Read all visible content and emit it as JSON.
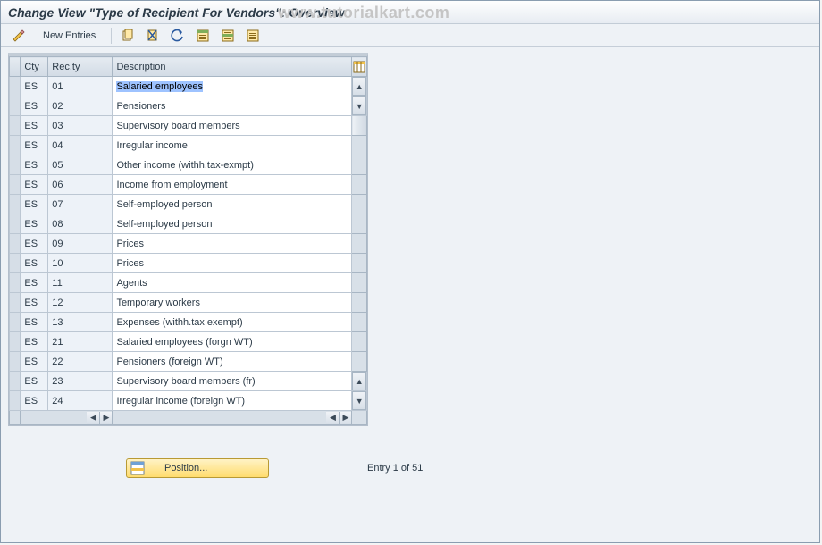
{
  "title": "Change View \"Type of Recipient For Vendors\": Overview",
  "watermark": "www.tutorialkart.com",
  "toolbar": {
    "new_entries": "New Entries"
  },
  "columns": {
    "cty": "Cty",
    "recty": "Rec.ty",
    "desc": "Description"
  },
  "rows": [
    {
      "cty": "ES",
      "rty": "01",
      "desc": "Salaried employees",
      "hl": true
    },
    {
      "cty": "ES",
      "rty": "02",
      "desc": "Pensioners"
    },
    {
      "cty": "ES",
      "rty": "03",
      "desc": "Supervisory board members"
    },
    {
      "cty": "ES",
      "rty": "04",
      "desc": "Irregular income"
    },
    {
      "cty": "ES",
      "rty": "05",
      "desc": "Other income (withh.tax-exmpt)"
    },
    {
      "cty": "ES",
      "rty": "06",
      "desc": "Income from employment"
    },
    {
      "cty": "ES",
      "rty": "07",
      "desc": "Self-employed person"
    },
    {
      "cty": "ES",
      "rty": "08",
      "desc": "Self-employed person"
    },
    {
      "cty": "ES",
      "rty": "09",
      "desc": "Prices"
    },
    {
      "cty": "ES",
      "rty": "10",
      "desc": "Prices"
    },
    {
      "cty": "ES",
      "rty": "11",
      "desc": "Agents"
    },
    {
      "cty": "ES",
      "rty": "12",
      "desc": "Temporary workers"
    },
    {
      "cty": "ES",
      "rty": "13",
      "desc": "Expenses (withh.tax exempt)"
    },
    {
      "cty": "ES",
      "rty": "21",
      "desc": "Salaried employees (forgn WT)"
    },
    {
      "cty": "ES",
      "rty": "22",
      "desc": "Pensioners (foreign WT)"
    },
    {
      "cty": "ES",
      "rty": "23",
      "desc": "Supervisory board members (fr)"
    },
    {
      "cty": "ES",
      "rty": "24",
      "desc": "Irregular income (foreign WT)"
    }
  ],
  "position_btn": "Position...",
  "entry_status": "Entry 1 of 51"
}
